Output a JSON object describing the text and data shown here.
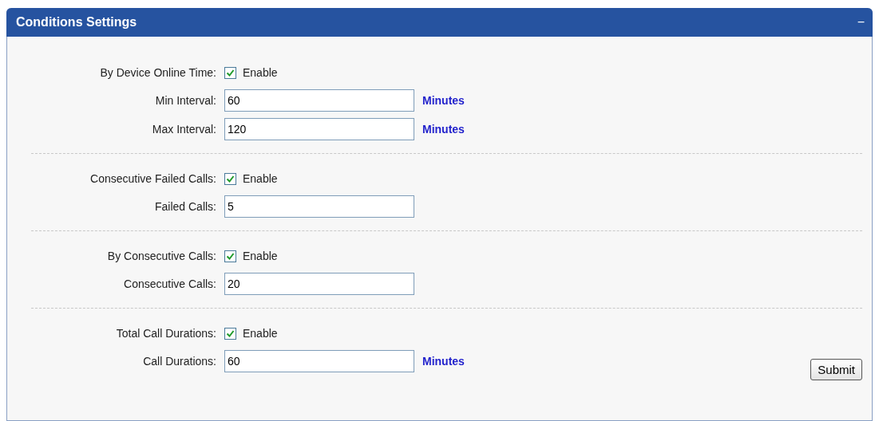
{
  "panel": {
    "title": "Conditions Settings",
    "collapse_icon": "−"
  },
  "sections": [
    {
      "label": "By Device Online Time:",
      "checkbox_label": "Enable",
      "checked": true,
      "fields": [
        {
          "label": "Min Interval:",
          "value": "60",
          "unit": "Minutes"
        },
        {
          "label": "Max Interval:",
          "value": "120",
          "unit": "Minutes"
        }
      ]
    },
    {
      "label": "Consecutive Failed Calls:",
      "checkbox_label": "Enable",
      "checked": true,
      "fields": [
        {
          "label": "Failed Calls:",
          "value": "5"
        }
      ]
    },
    {
      "label": "By Consecutive Calls:",
      "checkbox_label": "Enable",
      "checked": true,
      "fields": [
        {
          "label": "Consecutive Calls:",
          "value": "20"
        }
      ]
    },
    {
      "label": "Total Call Durations:",
      "checkbox_label": "Enable",
      "checked": true,
      "fields": [
        {
          "label": "Call Durations:",
          "value": "60",
          "unit": "Minutes"
        }
      ]
    }
  ],
  "submit": "Submit"
}
